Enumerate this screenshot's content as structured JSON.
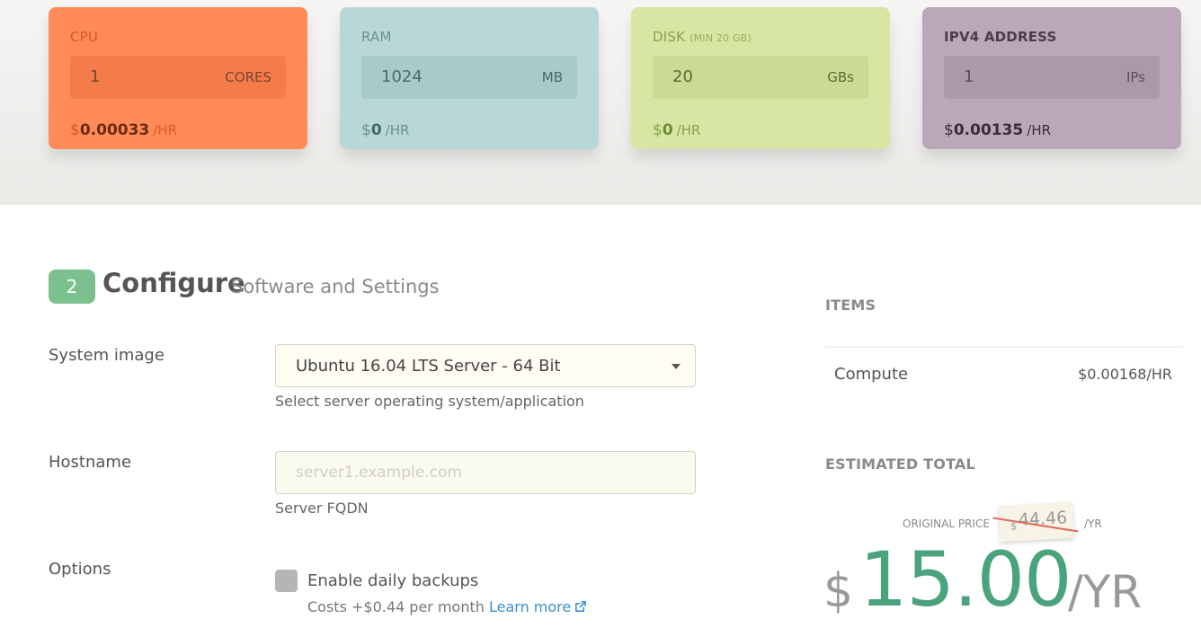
{
  "resources": {
    "cpu": {
      "title": "CPU",
      "value": "1",
      "unit": "CORES",
      "currency": "$",
      "price": "0.00033",
      "per": "/HR"
    },
    "ram": {
      "title": "RAM",
      "value": "1024",
      "unit": "MB",
      "currency": "$",
      "price": "0",
      "per": "/HR"
    },
    "disk": {
      "title": "DISK",
      "note": "(MIN 20 GB)",
      "value": "20",
      "unit": "GBs",
      "currency": "$",
      "price": "0",
      "per": "/HR"
    },
    "ipv4": {
      "title": "IPV4 ADDRESS",
      "value": "1",
      "unit": "IPs",
      "currency": "$",
      "price": "0.00135",
      "per": "/HR"
    }
  },
  "configure": {
    "step": "2",
    "title": "Configure",
    "subtitle": "Software and Settings",
    "system_image": {
      "label": "System image",
      "selected": "Ubuntu 16.04 LTS Server - 64 Bit",
      "help": "Select server operating system/application"
    },
    "hostname": {
      "label": "Hostname",
      "placeholder": "server1.example.com",
      "value": "",
      "help": "Server FQDN"
    },
    "options": {
      "label": "Options",
      "backup_label": "Enable daily backups",
      "backup_checked": false,
      "cost_note": "Costs +$0.44 per month",
      "learn_more": "Learn more"
    }
  },
  "summary": {
    "items_heading": "ITEMS",
    "items": [
      {
        "name": "Compute",
        "price": "$0.00168/HR"
      }
    ],
    "total_heading": "ESTIMATED TOTAL",
    "original_label": "ORIGINAL PRICE",
    "original_currency": "$",
    "original_price": "44.46",
    "original_per": "/YR",
    "total_currency": "$",
    "total_value": "15.00",
    "total_per": "/YR"
  },
  "colors": {
    "cpu": "#ff8b58",
    "ram": "#b8d8d8",
    "disk": "#d7e7a3",
    "ipv4": "#baa8ba",
    "accent_green": "#4aa37d",
    "link": "#3a8fc9"
  },
  "icons": {
    "select_caret": "caret-down-icon",
    "external_link": "external-link-icon"
  }
}
